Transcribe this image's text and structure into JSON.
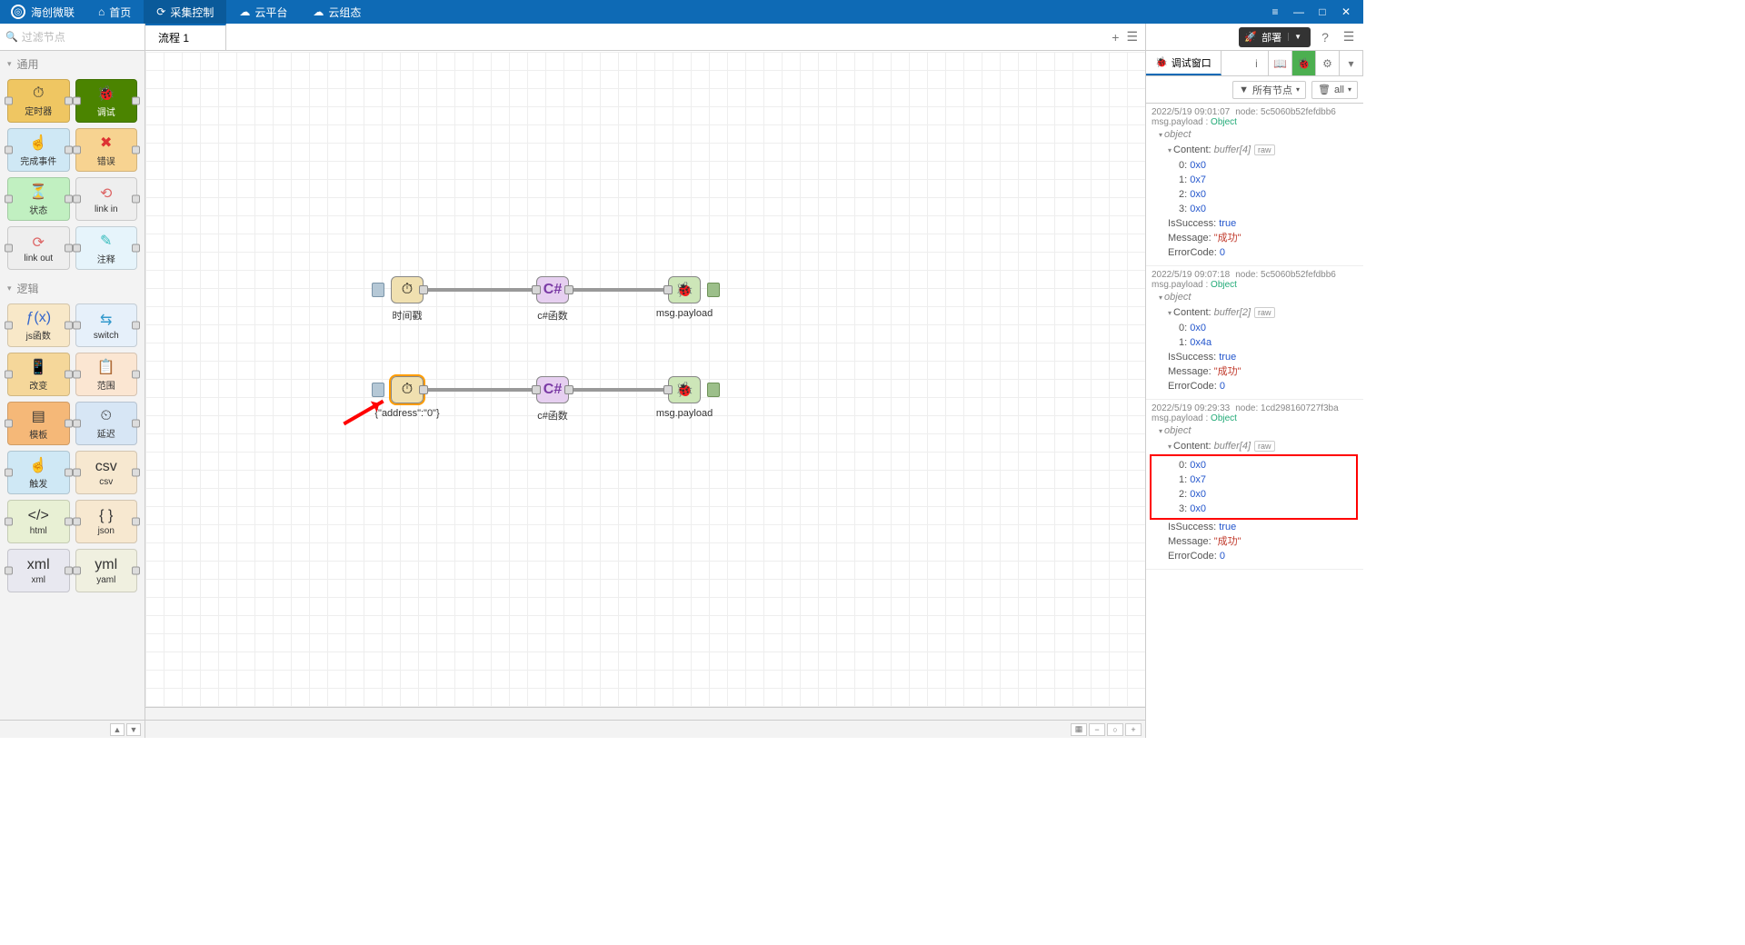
{
  "app": {
    "name": "海创微联"
  },
  "topnav": [
    {
      "label": "首页",
      "icon": "⌂",
      "active": false
    },
    {
      "label": "采集控制",
      "icon": "⟳",
      "active": true
    },
    {
      "label": "云平台",
      "icon": "☁",
      "active": false
    },
    {
      "label": "云组态",
      "icon": "☁",
      "active": false
    }
  ],
  "filter": {
    "placeholder": "过滤节点"
  },
  "palette": {
    "cat1": "通用",
    "cat2": "逻辑",
    "nodes": {
      "timer": "定时器",
      "debug": "调试",
      "complete": "完成事件",
      "error": "错误",
      "status": "状态",
      "linkin": "link in",
      "linkout": "link out",
      "comment": "注释",
      "jsfunc": "js函数",
      "switch": "switch",
      "change": "改变",
      "range": "范围",
      "template": "模板",
      "delay": "延迟",
      "trigger": "触发",
      "csv": "csv",
      "html": "html",
      "json": "json",
      "xml": "xml",
      "yaml": "yaml"
    }
  },
  "tabs": {
    "flow1": "流程 1"
  },
  "canvas": {
    "n1": "时间戳",
    "n2": "c#函数",
    "n3": "msg.payload",
    "n4": "{\"address\":\"0\"}",
    "n5": "c#函数",
    "n6": "msg.payload"
  },
  "deploy": {
    "label": "部署"
  },
  "debugTab": {
    "label": "调试窗口"
  },
  "filters": {
    "allNodes": "所有节点",
    "all": "all"
  },
  "messages": [
    {
      "ts": "2022/5/19 09:01:07",
      "node": "node: 5c5060b52fefdbb6",
      "prop": "msg.payload",
      "type": "Object",
      "obj": "object",
      "content_key": "Content",
      "content_type": "buffer[4]",
      "buf": [
        {
          "k": "0",
          "v": "0x0"
        },
        {
          "k": "1",
          "v": "0x7"
        },
        {
          "k": "2",
          "v": "0x0"
        },
        {
          "k": "3",
          "v": "0x0"
        }
      ],
      "success_k": "IsSuccess",
      "success_v": "true",
      "msg_k": "Message",
      "msg_v": "\"成功\"",
      "err_k": "ErrorCode",
      "err_v": "0"
    },
    {
      "ts": "2022/5/19 09:07:18",
      "node": "node: 5c5060b52fefdbb6",
      "prop": "msg.payload",
      "type": "Object",
      "obj": "object",
      "content_key": "Content",
      "content_type": "buffer[2]",
      "buf": [
        {
          "k": "0",
          "v": "0x0"
        },
        {
          "k": "1",
          "v": "0x4a"
        }
      ],
      "success_k": "IsSuccess",
      "success_v": "true",
      "msg_k": "Message",
      "msg_v": "\"成功\"",
      "err_k": "ErrorCode",
      "err_v": "0"
    },
    {
      "ts": "2022/5/19 09:29:33",
      "node": "node: 1cd298160727f3ba",
      "prop": "msg.payload",
      "type": "Object",
      "obj": "object",
      "content_key": "Content",
      "content_type": "buffer[4]",
      "buf": [
        {
          "k": "0",
          "v": "0x0"
        },
        {
          "k": "1",
          "v": "0x7"
        },
        {
          "k": "2",
          "v": "0x0"
        },
        {
          "k": "3",
          "v": "0x0"
        }
      ],
      "highlight": true,
      "success_k": "IsSuccess",
      "success_v": "true",
      "msg_k": "Message",
      "msg_v": "\"成功\"",
      "err_k": "ErrorCode",
      "err_v": "0"
    }
  ]
}
